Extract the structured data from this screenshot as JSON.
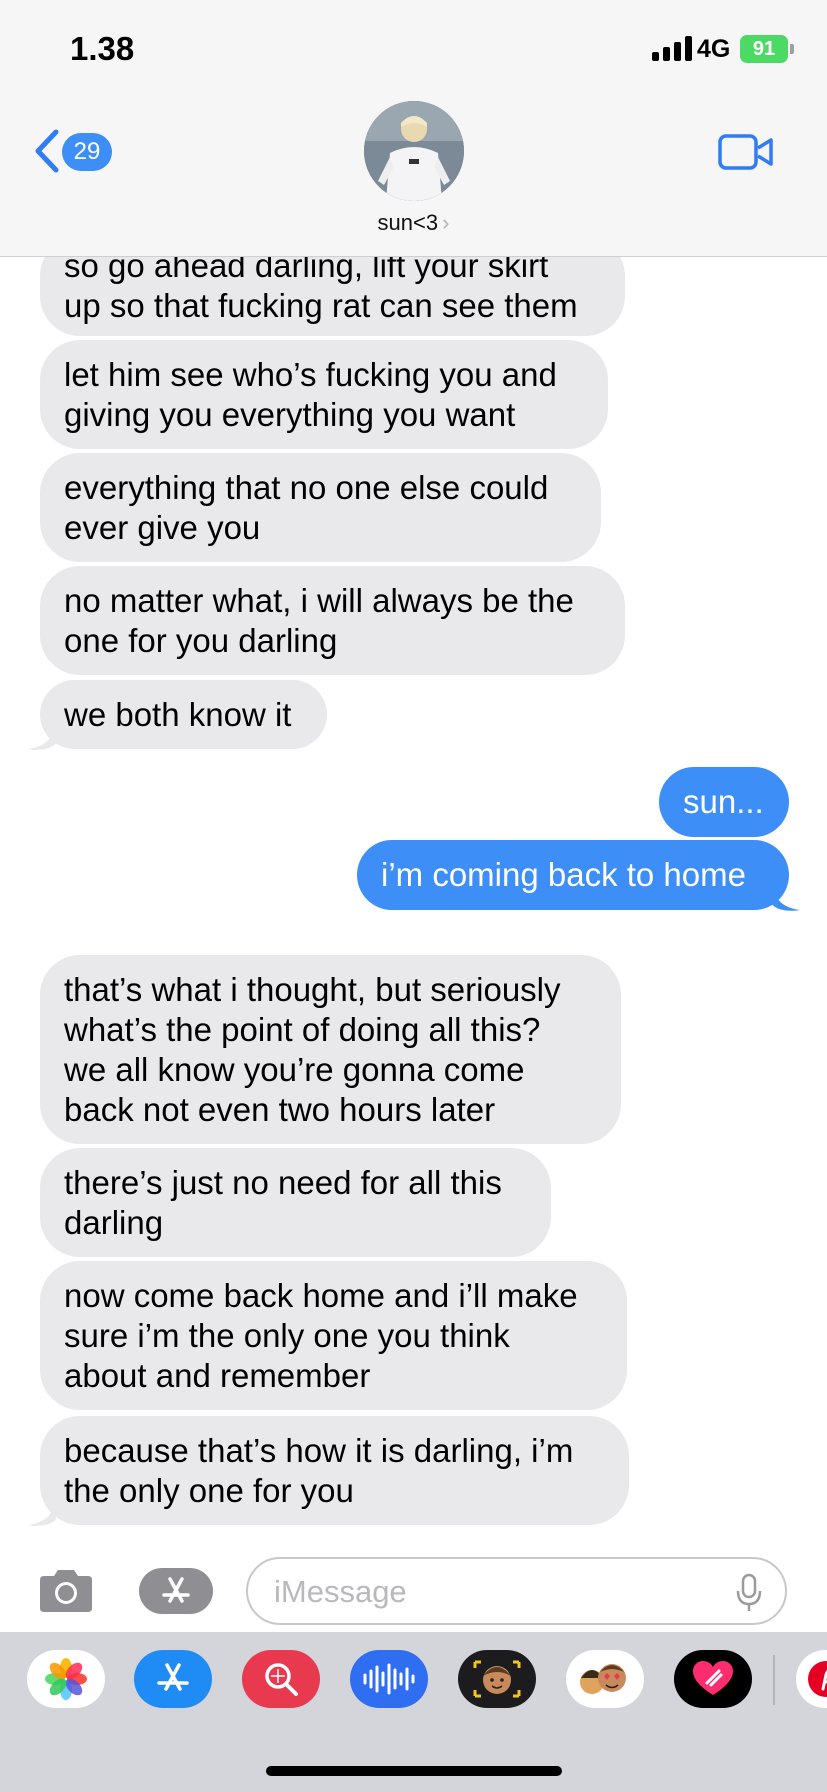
{
  "status_bar": {
    "time": "1.38",
    "network": "4G",
    "battery": "91"
  },
  "header": {
    "back_count": "29",
    "contact_name": "sun<3",
    "chevron": "›"
  },
  "messages": [
    {
      "from": "them",
      "text": "so go ahead darling, lift your skirt\nup so that fucking rat can see them"
    },
    {
      "from": "them",
      "text": "let him see who’s fucking you and\ngiving you everything you want"
    },
    {
      "from": "them",
      "text": "everything that no one else could\never give you"
    },
    {
      "from": "them",
      "text": "no matter what, i will always be the\none for you darling"
    },
    {
      "from": "them",
      "text": "we both know it"
    },
    {
      "from": "me",
      "text": "sun..."
    },
    {
      "from": "me",
      "text": "i’m coming back to home"
    },
    {
      "from": "them",
      "text": "that’s what i thought, but seriously\nwhat’s the point of doing all this?\nwe all know you’re gonna come\nback not even two hours later"
    },
    {
      "from": "them",
      "text": "there’s just no need for all this\ndarling"
    },
    {
      "from": "them",
      "text": "now come back home and i’ll make\nsure i’m the only one you think\nabout and remember"
    },
    {
      "from": "them",
      "text": "because that’s how it is darling, i’m\nthe only one for you"
    }
  ],
  "composer": {
    "placeholder": "iMessage"
  },
  "app_drawer": [
    {
      "icon": "photos-icon",
      "color": "#ffffff"
    },
    {
      "icon": "app-store-icon",
      "color": "#1f8cf5"
    },
    {
      "icon": "image-search-icon",
      "color": "#e8394e"
    },
    {
      "icon": "audio-waveform-icon",
      "color": "#2f6ef0"
    },
    {
      "icon": "memoji-icon",
      "color": "#1c1c1e"
    },
    {
      "icon": "memoji-stickers-icon",
      "color": "#ffffff"
    },
    {
      "icon": "digital-touch-icon",
      "color": "#000000"
    },
    {
      "icon": "pinterest-icon",
      "color": "#ffffff"
    }
  ],
  "colors": {
    "outgoing": "#3e8ef7",
    "incoming": "#e9e9eb",
    "accent": "#2f7cf6"
  }
}
